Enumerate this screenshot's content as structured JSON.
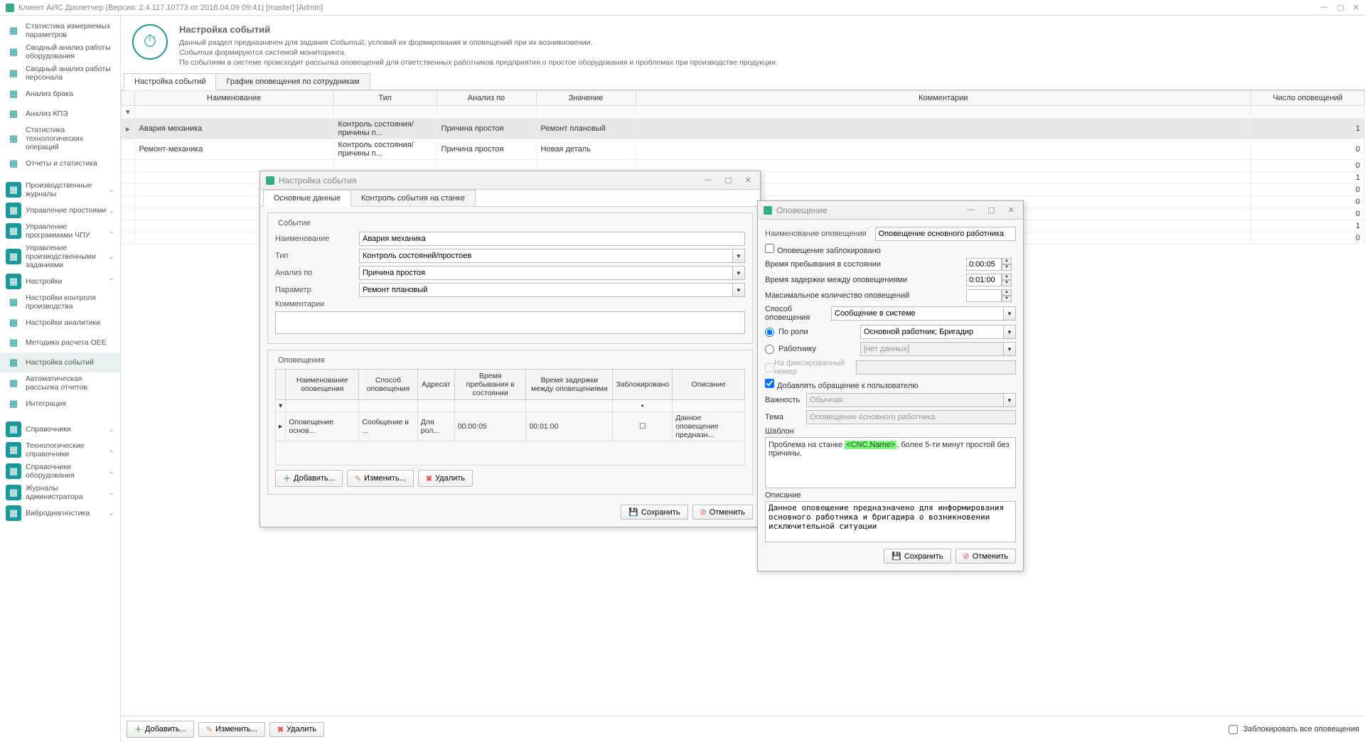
{
  "titlebar": "Клиент АИС Диспетчер (Версия: 2.4.117.10773 от 2018.04.09 09:41)  [master]  [Admin]",
  "sidebar": {
    "items1": [
      {
        "label": "Статистика измеряемых параметров"
      },
      {
        "label": "Сводный анализ работы оборудования"
      },
      {
        "label": "Сводный анализ работы персонала"
      },
      {
        "label": "Анализ брака"
      },
      {
        "label": "Анализ КПЭ"
      },
      {
        "label": "Статистика технологических операций"
      },
      {
        "label": "Отчеты и статистика"
      }
    ],
    "groups": [
      {
        "label": "Производственные журналы"
      },
      {
        "label": "Управление простоями"
      },
      {
        "label": "Управление программами ЧПУ"
      },
      {
        "label": "Управление производственными заданиями"
      },
      {
        "label": "Настройки",
        "expanded": true
      }
    ],
    "settings": [
      {
        "label": "Настройки контроля производства"
      },
      {
        "label": "Настройки аналитики"
      },
      {
        "label": "Методика расчета OEE"
      },
      {
        "label": "Настройка событий",
        "active": true
      },
      {
        "label": "Автоматическая рассылка отчетов"
      },
      {
        "label": "Интеграция"
      }
    ],
    "groups2": [
      {
        "label": "Справочники"
      },
      {
        "label": "Технологические справочники"
      },
      {
        "label": "Справочники оборудования"
      },
      {
        "label": "Журналы администратора"
      },
      {
        "label": "Вибродиагностика"
      }
    ]
  },
  "page": {
    "title": "Настройка событий",
    "desc1": "Данный раздел предназначен для задания ",
    "desc1em": "Событий",
    "desc1b": ", условий их формирования и оповещений при их возникновении.",
    "desc2a": "События",
    "desc2": " формируются системой мониторинга.",
    "desc3": "По событиям в системе происходит рассылка оповещений для ответственных работников предприятия о простое оборудования и проблемах при производстве продукции."
  },
  "tabs": {
    "t1": "Настройка событий",
    "t2": "График оповещения по сотрудникам"
  },
  "mainGrid": {
    "cols": [
      "Наименование",
      "Тип",
      "Анализ по",
      "Значение",
      "Комментарии",
      "Число оповещений"
    ],
    "rows": [
      {
        "n": "Авария механика",
        "t": "Контроль состояния/причины п...",
        "a": "Причина простоя",
        "v": "Ремонт плановый",
        "c": "",
        "cnt": "1",
        "sel": true
      },
      {
        "n": "Ремонт-механика",
        "t": "Контроль состояния/причины п...",
        "a": "Причина простоя",
        "v": "Новая деталь",
        "c": "",
        "cnt": "0"
      },
      {
        "cnt": "0"
      },
      {
        "cnt": "1"
      },
      {
        "cnt": "0"
      },
      {
        "cnt": "0"
      },
      {
        "cnt": "0"
      },
      {
        "cnt": "1"
      },
      {
        "cnt": "0"
      }
    ]
  },
  "dlg1": {
    "title": "Настройка события",
    "tabs": {
      "t1": "Основные данные",
      "t2": "Контроль события на станке"
    },
    "fs1": "Событие",
    "labels": {
      "name": "Наименование",
      "type": "Тип",
      "analysis": "Анализ по",
      "param": "Параметр",
      "comment": "Комментарии"
    },
    "values": {
      "name": "Авария механика",
      "type": "Контроль состояний/простоев",
      "analysis": "Причина простоя",
      "param": "Ремонт плановый"
    },
    "fs2": "Оповещения",
    "innerCols": [
      "Наименование оповещения",
      "Способ оповещения",
      "Адресат",
      "Время пребывания в состоянии",
      "Время задержки между оповещениями",
      "Заблокировано",
      "Описание"
    ],
    "innerRow": {
      "n": "Оповещение основ...",
      "s": "Сообщение в ...",
      "a": "Для рол...",
      "t1": "00:00:05",
      "t2": "00:01:00",
      "d": "Данное оповещение предназн..."
    },
    "btns": {
      "add": "Добавить...",
      "edit": "Изменить...",
      "del": "Удалить",
      "save": "Сохранить",
      "cancel": "Отменить"
    }
  },
  "dlg2": {
    "title": "Оповещение",
    "labels": {
      "name": "Наименование оповещения",
      "blocked": "Оповещение заблокировано",
      "stayTime": "Время пребывания в состоянии",
      "delayTime": "Время задержки между оповещениями",
      "maxCount": "Максимальное количество оповещений",
      "method": "Способ оповещения",
      "byRole": "По роли",
      "toWorker": "Работнику",
      "fixedNum": "На фиксированный номер",
      "addAddress": "Добавлять обращение к пользователю",
      "priority": "Важность",
      "subject": "Тема",
      "template": "Шаблон",
      "desc": "Описание"
    },
    "values": {
      "name": "Оповещение основного работника",
      "stayTime": "0:00:05",
      "delayTime": "0:01:00",
      "method": "Сообщение в системе",
      "role": "Основной работник; Бригадир",
      "worker": "[нет данных]",
      "priority": "Обычная",
      "subject": "Оповещение основного работника",
      "templatePre": "Проблема на станке ",
      "templateTag": "<CNC.Name>",
      "templatePost": ", более 5-ти минут простой без причины.",
      "desc": "Данное оповещение предназначено для информирования основного работника и бригадира о возникновении исключительной ситуации"
    },
    "btns": {
      "save": "Сохранить",
      "cancel": "Отменить"
    }
  },
  "bottomBar": {
    "add": "Добавить...",
    "edit": "Изменить...",
    "del": "Удалить",
    "blockAll": "Заблокировать все оповещения"
  }
}
